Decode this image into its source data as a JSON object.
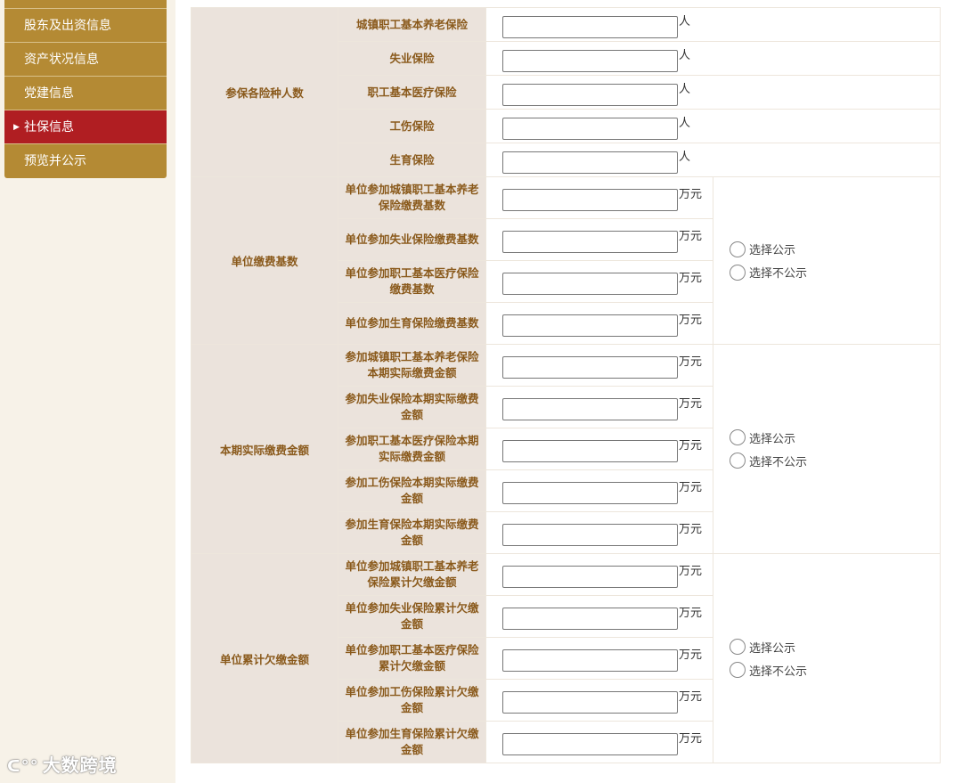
{
  "sidebar": {
    "items": [
      {
        "label": "股东及出资信息",
        "active": false
      },
      {
        "label": "资产状况信息",
        "active": false
      },
      {
        "label": "党建信息",
        "active": false
      },
      {
        "label": "社保信息",
        "active": true
      },
      {
        "label": "预览并公示",
        "active": false
      }
    ]
  },
  "watermark": {
    "text": "大数跨境"
  },
  "sections": [
    {
      "title": "参保各险种人数",
      "unit": "人",
      "rows": [
        "城镇职工基本养老保险",
        "失业保险",
        "职工基本医疗保险",
        "工伤保险",
        "生育保险"
      ]
    },
    {
      "title": "单位缴费基数",
      "unit": "万元",
      "rows": [
        "单位参加城镇职工基本养老保险缴费基数",
        "单位参加失业保险缴费基数",
        "单位参加职工基本医疗保险缴费基数",
        "单位参加生育保险缴费基数"
      ],
      "options": [
        "选择公示",
        "选择不公示"
      ]
    },
    {
      "title": "本期实际缴费金额",
      "unit": "万元",
      "rows": [
        "参加城镇职工基本养老保险本期实际缴费金额",
        "参加失业保险本期实际缴费金额",
        "参加职工基本医疗保险本期实际缴费金额",
        "参加工伤保险本期实际缴费金额",
        "参加生育保险本期实际缴费金额"
      ],
      "options": [
        "选择公示",
        "选择不公示"
      ]
    },
    {
      "title": "单位累计欠缴金额",
      "unit": "万元",
      "rows": [
        "单位参加城镇职工基本养老保险累计欠缴金额",
        "单位参加失业保险累计欠缴金额",
        "单位参加职工基本医疗保险累计欠缴金额",
        "单位参加工伤保险累计欠缴金额",
        "单位参加生育保险累计欠缴金额"
      ],
      "options": [
        "选择公示",
        "选择不公示"
      ]
    }
  ]
}
